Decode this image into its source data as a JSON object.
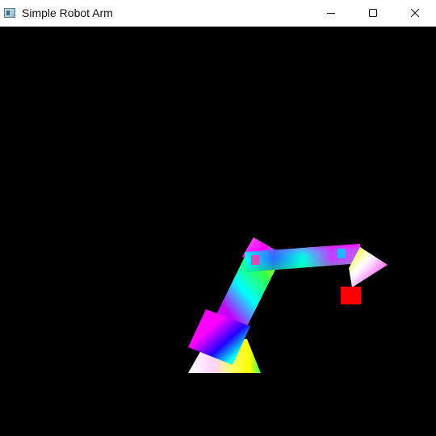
{
  "window": {
    "title": "Simple Robot Arm",
    "icon": "app-window-icon",
    "controls": {
      "minimize_icon": "minimize-icon",
      "maximize_icon": "maximize-icon",
      "close_icon": "close-icon"
    }
  },
  "scene": {
    "background": "#000000",
    "target_marker_color": "#ff0000",
    "parts": [
      "base",
      "lower-arm",
      "joint",
      "upper-arm",
      "gripper",
      "target-cube"
    ]
  }
}
